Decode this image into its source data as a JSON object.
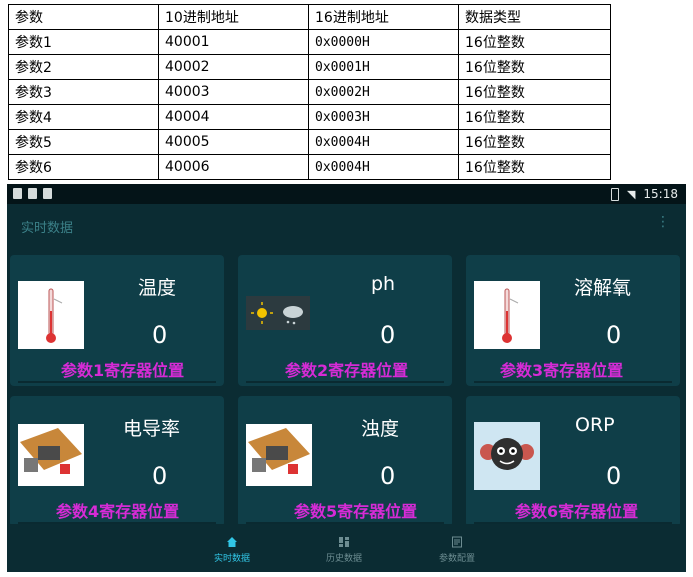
{
  "table": {
    "header": [
      "参数",
      "10进制地址",
      "16进制地址",
      "数据类型"
    ],
    "rows": [
      [
        "参数1",
        "40001",
        "0x0000H",
        "16位整数"
      ],
      [
        "参数2",
        "40002",
        "0x0001H",
        "16位整数"
      ],
      [
        "参数3",
        "40003",
        "0x0002H",
        "16位整数"
      ],
      [
        "参数4",
        "40004",
        "0x0003H",
        "16位整数"
      ],
      [
        "参数5",
        "40005",
        "0x0004H",
        "16位整数"
      ],
      [
        "参数6",
        "40006",
        "0x0004H",
        "16位整数"
      ]
    ]
  },
  "status_bar": {
    "time": "15:18"
  },
  "app_bar": {
    "title": "实时数据",
    "menu_icon": "more-vert-icon"
  },
  "cards": [
    {
      "title": "温度",
      "value": "0",
      "register": "参数1寄存器位置",
      "icon": "thermometer-icon"
    },
    {
      "title": "ph",
      "value": "0",
      "register": "参数2寄存器位置",
      "icon": "weather-icon"
    },
    {
      "title": "溶解氧",
      "value": "0",
      "register": "参数3寄存器位置",
      "icon": "thermometer-icon"
    },
    {
      "title": "电导率",
      "value": "0",
      "register": "参数4寄存器位置",
      "icon": "circuit-board-icon"
    },
    {
      "title": "浊度",
      "value": "0",
      "register": "参数5寄存器位置",
      "icon": "circuit-board-icon"
    },
    {
      "title": "ORP",
      "value": "0",
      "register": "参数6寄存器位置",
      "icon": "bacteria-icon"
    }
  ],
  "bottom_nav": [
    {
      "label": "实时数据",
      "icon": "home-icon",
      "active": true
    },
    {
      "label": "历史数据",
      "icon": "dashboard-icon",
      "active": false
    },
    {
      "label": "参数配置",
      "icon": "settings-doc-icon",
      "active": false
    }
  ],
  "colors": {
    "background": "#0b2c33",
    "card": "#0f3e48",
    "register_text": "#d62bd6",
    "active_nav": "#31c6e6"
  }
}
